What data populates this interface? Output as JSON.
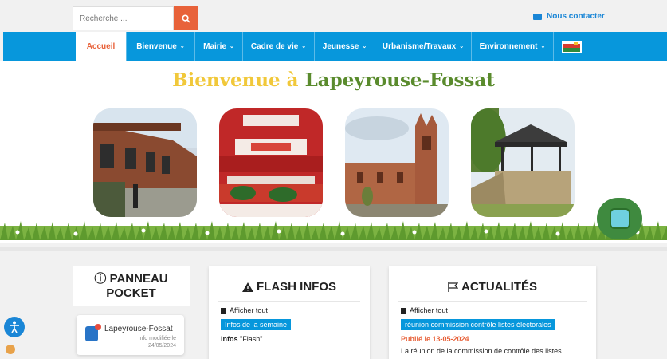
{
  "search": {
    "placeholder": "Recherche ..."
  },
  "contact": {
    "label": "Nous contacter"
  },
  "nav": {
    "items": [
      {
        "label": "Accueil"
      },
      {
        "label": "Bienvenue"
      },
      {
        "label": "Mairie"
      },
      {
        "label": "Cadre de vie"
      },
      {
        "label": "Jeunesse"
      },
      {
        "label": "Urbanisme/Travaux"
      },
      {
        "label": "Environnement"
      }
    ]
  },
  "hero": {
    "title_part1": "Bienvenue à",
    "title_part2": "Lapeyrouse-Fossat"
  },
  "panneau": {
    "title_line1": "PANNEAU",
    "title_line2": "POCKET",
    "app_name": "Lapeyrouse-Fossat",
    "app_info_line1": "Info modifiée le",
    "app_info_line2": "24/05/2024"
  },
  "flash": {
    "title": "FLASH INFOS",
    "show_all": "Afficher tout",
    "tag": "Infos de la semaine",
    "text_bold": "Infos",
    "text_rest": " \"Flash\"..."
  },
  "actualites": {
    "title": "ACTUALITÉS",
    "show_all": "Afficher tout",
    "tag": "réunion commission contrôle listes électorales",
    "date": "Publié le 13-05-2024",
    "desc": "La réunion de la commission de contrôle des listes"
  },
  "colors": {
    "nav": "#0797dc",
    "accent": "#e8623a",
    "title_yellow": "#f1c83a",
    "title_green": "#5a8b2d"
  }
}
